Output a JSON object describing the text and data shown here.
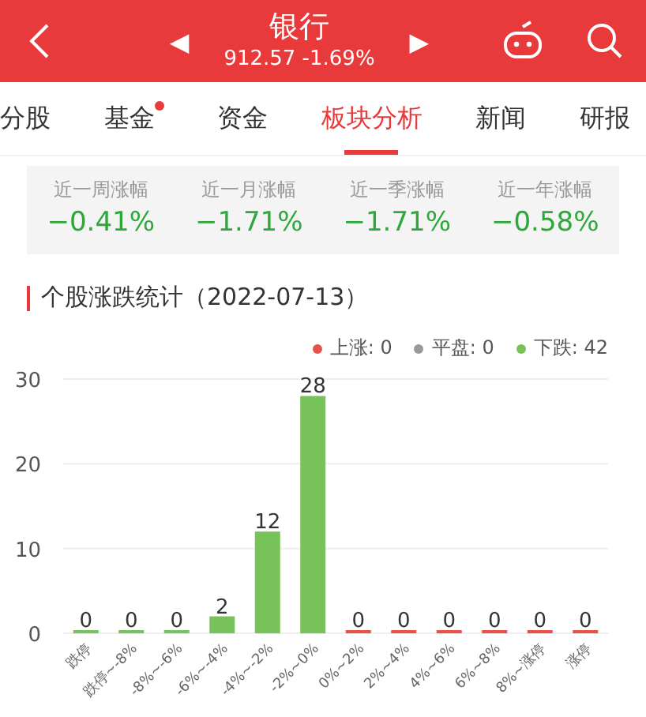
{
  "header": {
    "title": "银行",
    "prev": "◀",
    "next": "▶",
    "quote": "912.57 -1.69%"
  },
  "tabs": [
    {
      "label": "分股",
      "selected": false,
      "dot": false
    },
    {
      "label": "基金",
      "selected": false,
      "dot": true
    },
    {
      "label": "资金",
      "selected": false,
      "dot": false
    },
    {
      "label": "板块分析",
      "selected": true,
      "dot": false
    },
    {
      "label": "新闻",
      "selected": false,
      "dot": false
    },
    {
      "label": "研报",
      "selected": false,
      "dot": false
    }
  ],
  "stats": [
    {
      "label": "近一周涨幅",
      "value": "−0.41%"
    },
    {
      "label": "近一月涨幅",
      "value": "−1.71%"
    },
    {
      "label": "近一季涨幅",
      "value": "−1.71%"
    },
    {
      "label": "近一年涨幅",
      "value": "−0.58%"
    }
  ],
  "section_title": "个股涨跌统计（2022-07-13）",
  "legend": [
    {
      "label": "上涨: 0",
      "color": "#e8504a"
    },
    {
      "label": "平盘: 0",
      "color": "#999999"
    },
    {
      "label": "下跌: 42",
      "color": "#78c25a"
    }
  ],
  "chart_data": {
    "type": "bar",
    "categories": [
      "跌停",
      "跌停~-8%",
      "-8%~-6%",
      "-6%~-4%",
      "-4%~-2%",
      "-2%~0%",
      "0%~2%",
      "2%~4%",
      "4%~6%",
      "6%~8%",
      "8%~涨停",
      "涨停"
    ],
    "series": [
      {
        "color": "#78c25a",
        "values": [
          0,
          0,
          0,
          2,
          12,
          28,
          null,
          null,
          null,
          null,
          null,
          null
        ]
      },
      {
        "color": "#e8504a",
        "values": [
          null,
          null,
          null,
          null,
          null,
          null,
          0,
          0,
          0,
          0,
          0,
          0
        ]
      }
    ],
    "ylim": [
      0,
      30
    ],
    "yticks": [
      0,
      10,
      20,
      30
    ],
    "data_labels": true
  }
}
